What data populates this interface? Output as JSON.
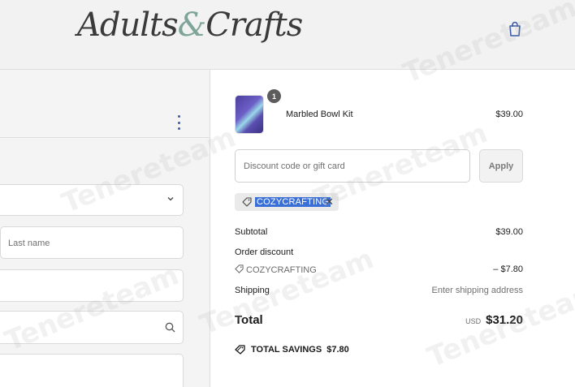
{
  "header": {
    "logo_text_a": "Adults",
    "logo_amp": "&",
    "logo_text_b": "Crafts",
    "cart_icon": "shopping-bag-icon"
  },
  "left": {
    "menu_icon": "vertical-dots-icon",
    "fields": [
      {
        "placeholder": ""
      },
      {
        "placeholder": "Last name"
      },
      {
        "placeholder": ""
      },
      {
        "placeholder": ""
      },
      {
        "placeholder": ""
      }
    ]
  },
  "order": {
    "item": {
      "quantity": "1",
      "name": "Marbled Bowl Kit",
      "price": "$39.00"
    },
    "discount": {
      "placeholder": "Discount code or gift card",
      "apply_label": "Apply",
      "applied_code": "COZYCRAFTING"
    },
    "summary": {
      "subtotal_label": "Subtotal",
      "subtotal_value": "$39.00",
      "order_discount_label": "Order discount",
      "discount_code": "COZYCRAFTING",
      "discount_value": "– $7.80",
      "shipping_label": "Shipping",
      "shipping_value": "Enter shipping address",
      "total_label": "Total",
      "currency": "USD",
      "total_value": "$31.20",
      "savings_label": "TOTAL SAVINGS",
      "savings_value": "$7.80"
    }
  },
  "watermark": "Tenereteam",
  "colors": {
    "accent_blue": "#3a6fd8",
    "logo_amp": "#7fa59b"
  }
}
